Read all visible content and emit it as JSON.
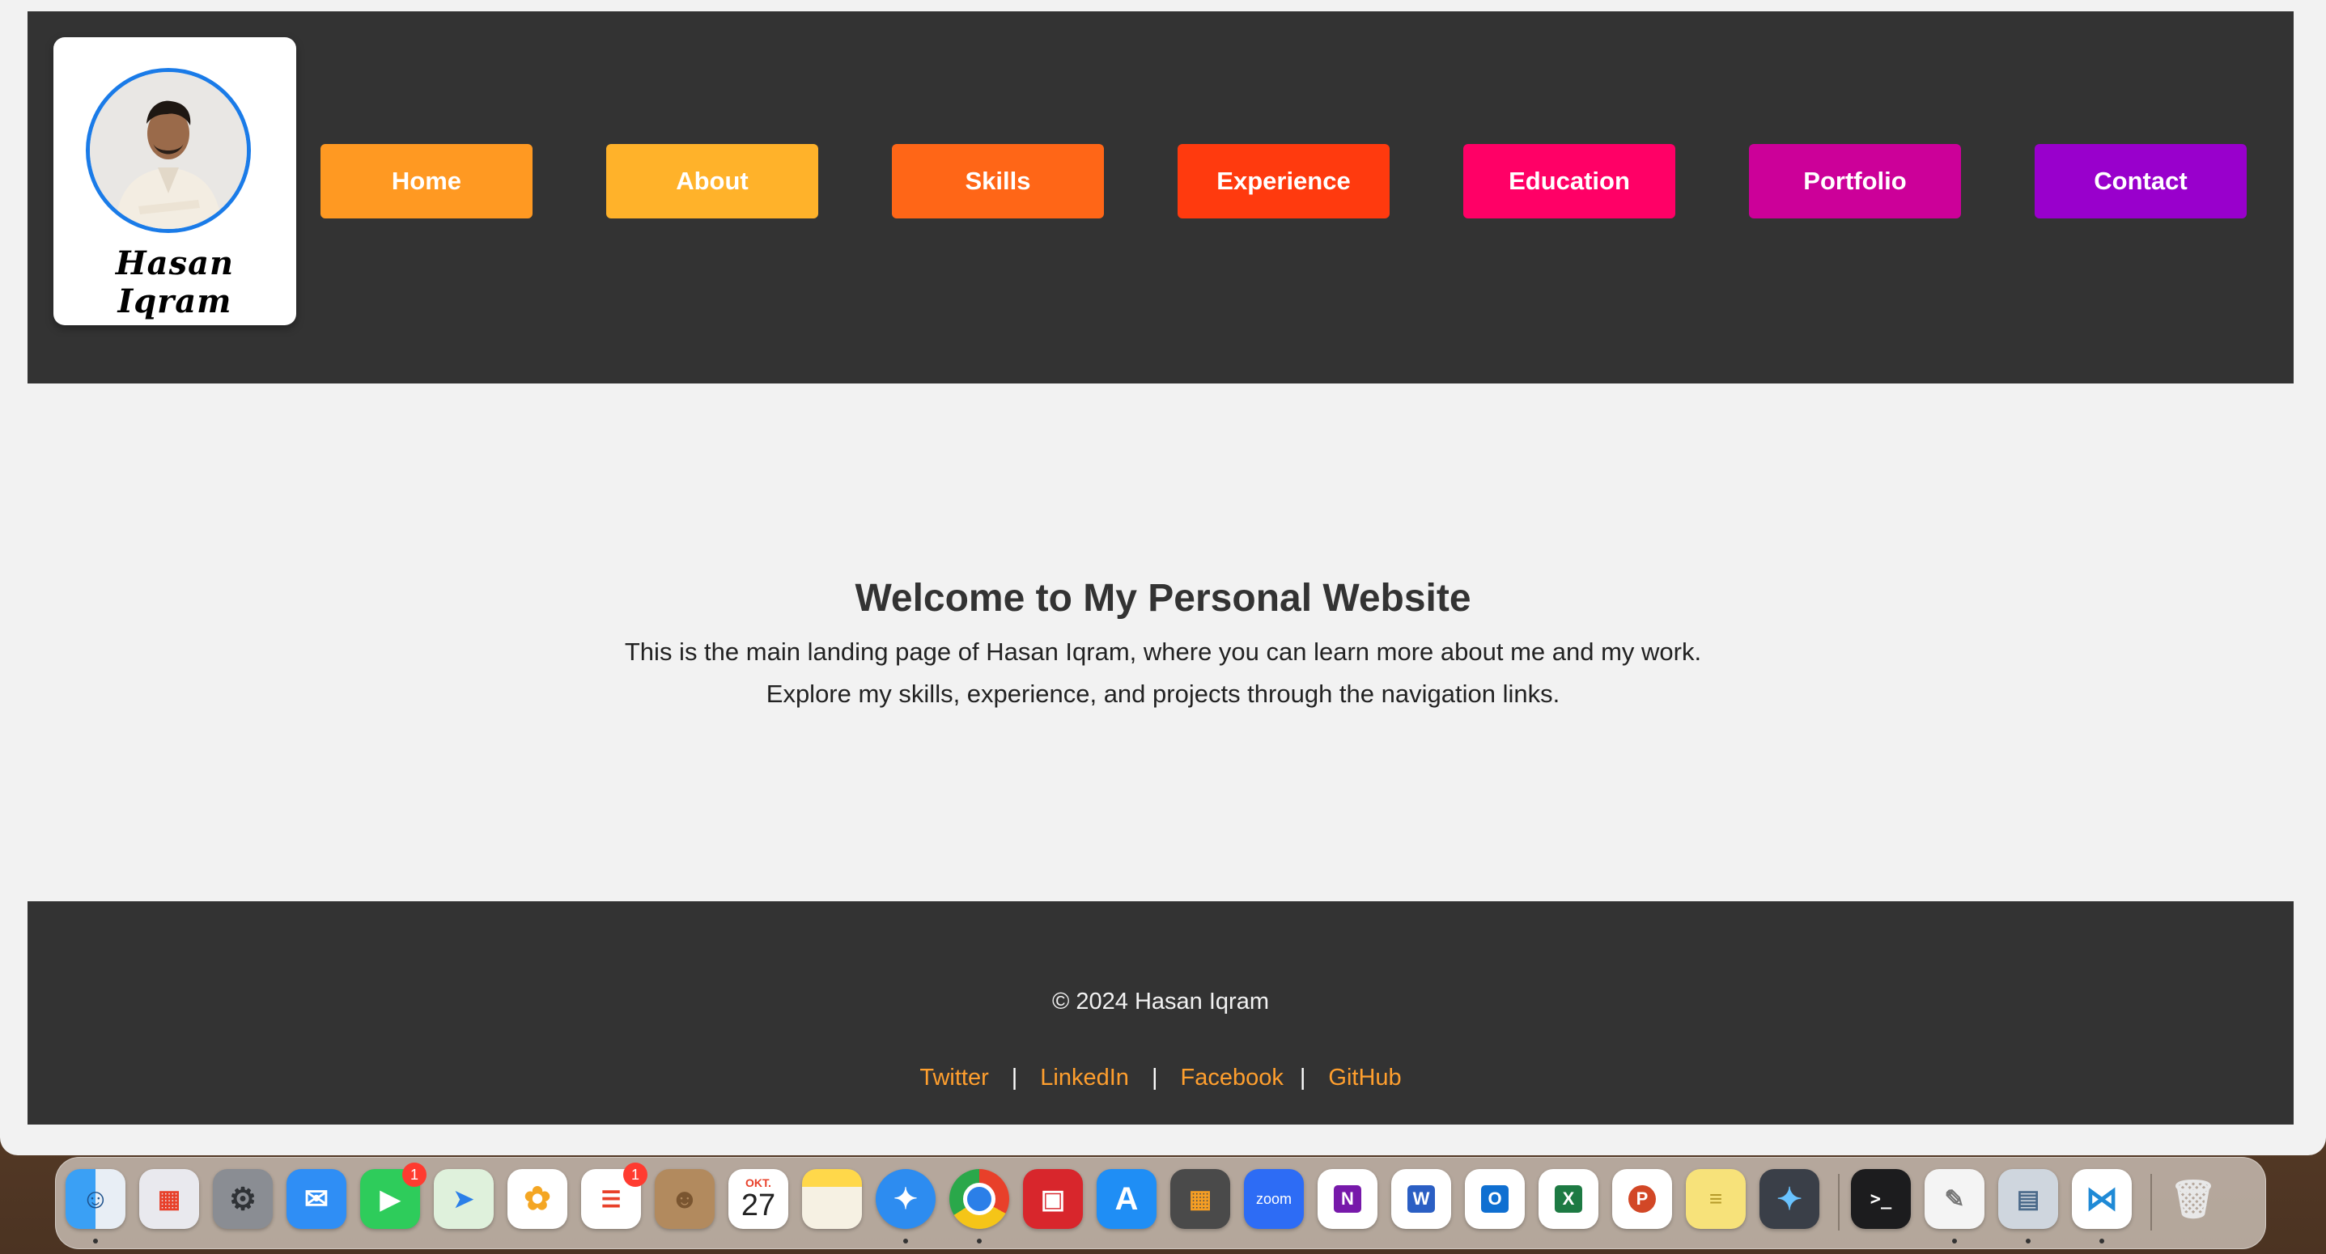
{
  "logo": {
    "name": "Hasan Iqram"
  },
  "nav": {
    "items": [
      {
        "label": "Home",
        "color": "#ff9922"
      },
      {
        "label": "About",
        "color": "#ffb22a"
      },
      {
        "label": "Skills",
        "color": "#ff6617"
      },
      {
        "label": "Experience",
        "color": "#ff3a0e"
      },
      {
        "label": "Education",
        "color": "#ff0066"
      },
      {
        "label": "Portfolio",
        "color": "#cc0099"
      },
      {
        "label": "Contact",
        "color": "#9900cc"
      }
    ]
  },
  "main": {
    "title": "Welcome to My Personal Website",
    "line1": "This is the main landing page of Hasan Iqram, where you can learn more about me and my work.",
    "line2": "Explore my skills, experience, and projects through the navigation links."
  },
  "footer": {
    "copyright": "© 2024 Hasan Iqram",
    "links": [
      "Twitter",
      "LinkedIn",
      "Facebook",
      "GitHub"
    ],
    "link_color": "#ff9f2e"
  },
  "dock": {
    "facetime_badge": "1",
    "reminders_badge": "1",
    "calendar_month": "OKT.",
    "calendar_day": "27",
    "zoom_label": "zoom"
  }
}
